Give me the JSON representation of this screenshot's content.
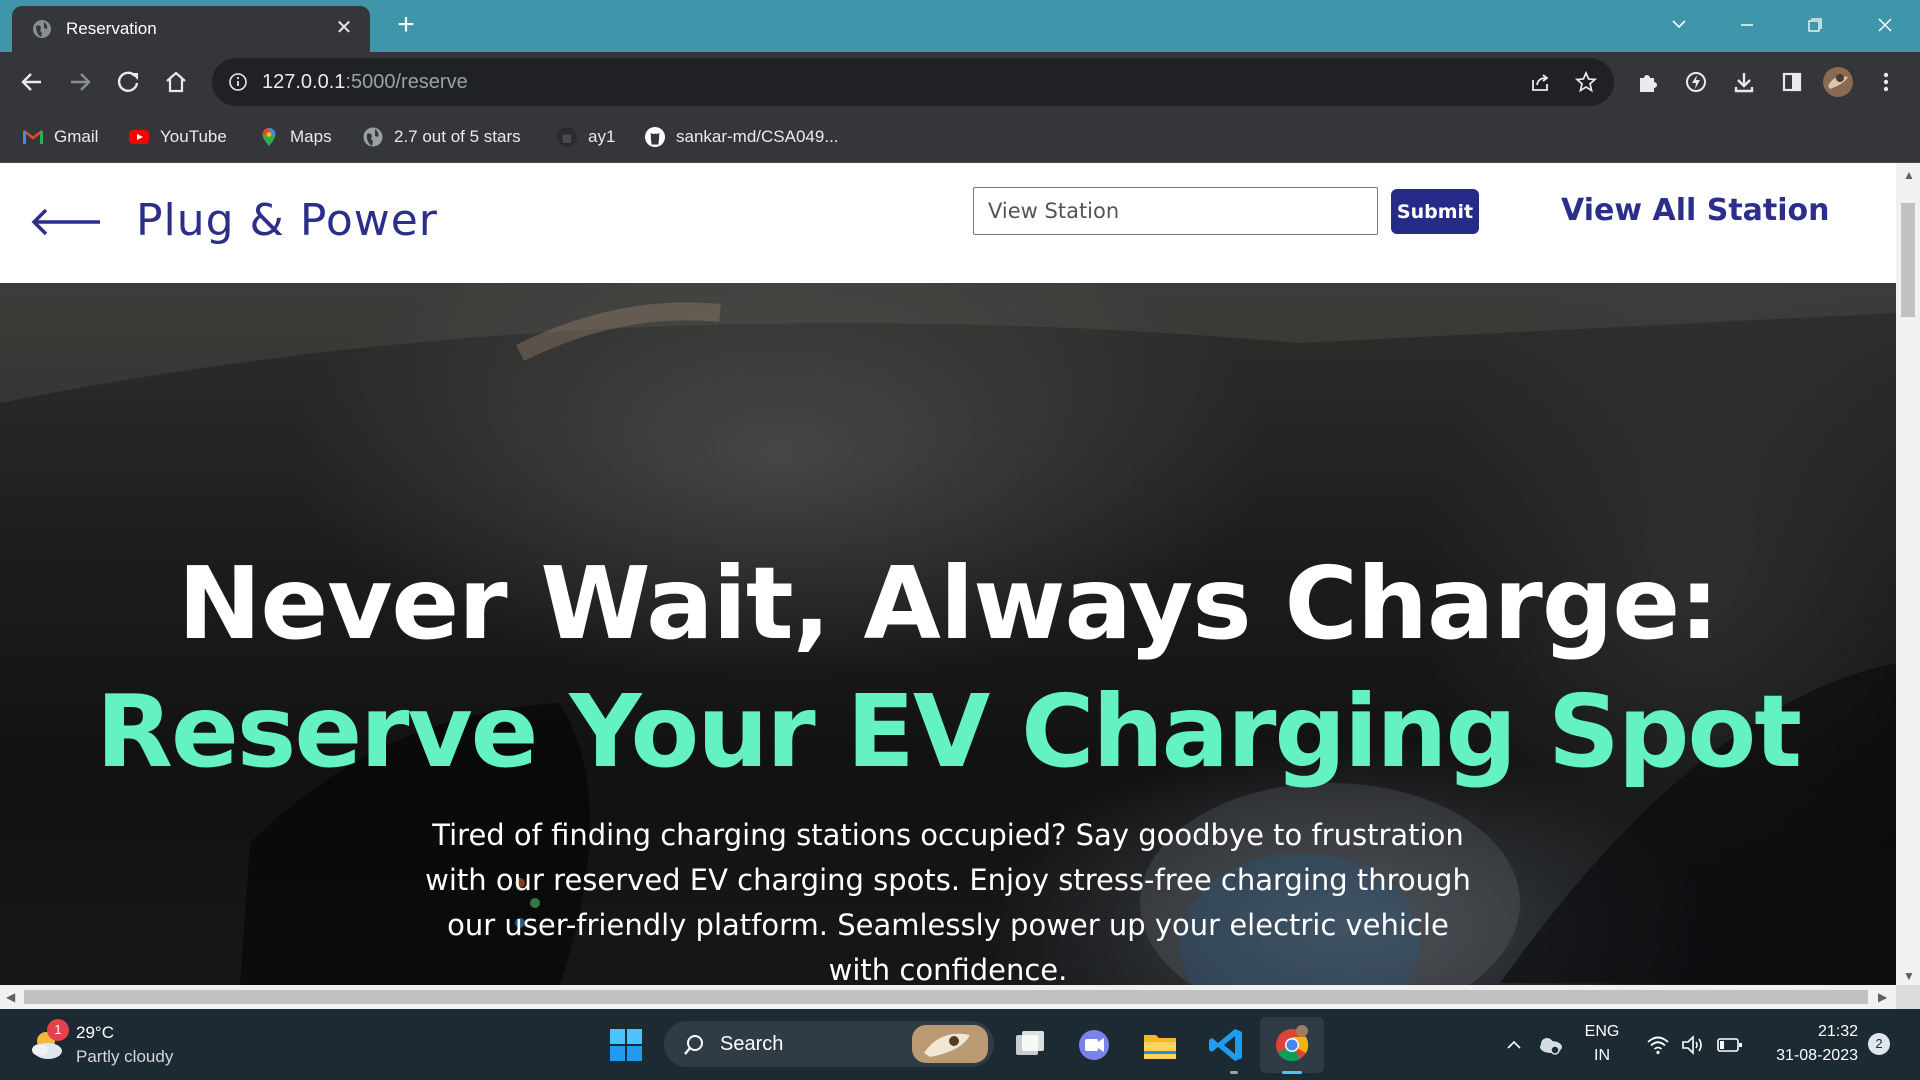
{
  "browser": {
    "tab_title": "Reservation",
    "tab_close": "✕",
    "new_tab": "+",
    "url_host": "127.0.0.1",
    "url_path": ":5000/reserve",
    "bookmarks": [
      {
        "label": "Gmail",
        "icon": "gmail-icon"
      },
      {
        "label": "YouTube",
        "icon": "youtube-icon"
      },
      {
        "label": "Maps",
        "icon": "maps-icon"
      },
      {
        "label": "2.7 out of 5 stars",
        "icon": "globe-icon"
      },
      {
        "label": "ay1",
        "icon": "github-icon"
      },
      {
        "label": "sankar-md/CSA049...",
        "icon": "github-icon"
      }
    ]
  },
  "header": {
    "brand": "Plug & Power",
    "search_placeholder": "View Station",
    "submit_label": "Submit",
    "view_all_label": "View All Station"
  },
  "hero": {
    "headline_1": "Never Wait, Always Charge:",
    "headline_2": "Reserve Your EV Charging Spot",
    "headline_2_color": "#64f2c4",
    "description": "Tired of finding charging stations occupied? Say goodbye to frustration with our reserved EV charging spots. Enjoy stress-free charging through our user-friendly platform. Seamlessly power up your electric vehicle with confidence."
  },
  "taskbar": {
    "weather_temp": "29°C",
    "weather_desc": "Partly cloudy",
    "weather_badge": "1",
    "search_label": "Search",
    "lang_1": "ENG",
    "lang_2": "IN",
    "time": "21:32",
    "date": "31-08-2023",
    "notification_count": "2"
  },
  "colors": {
    "brand_blue": "#2b2f8a",
    "submit_bg": "#262b8a",
    "accent_green": "#64f2c4",
    "chrome_frame": "#3f95a9"
  }
}
